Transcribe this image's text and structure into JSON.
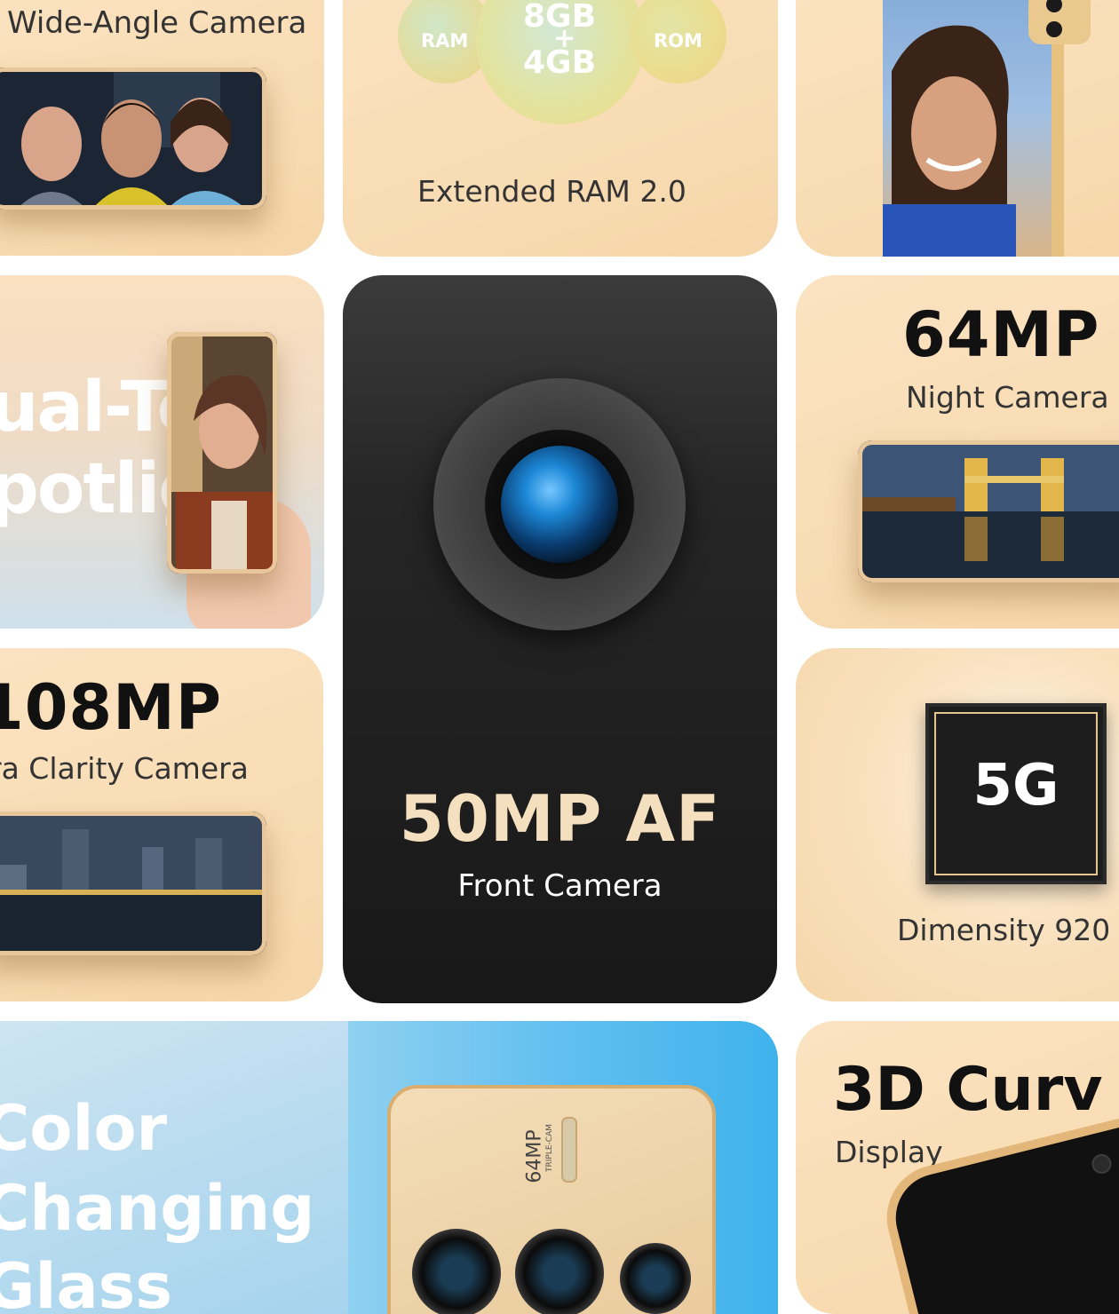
{
  "tiles": {
    "wide_angle": {
      "title": "Wide-Angle Camera"
    },
    "ram": {
      "ram_label": "RAM",
      "rom_label": "ROM",
      "capacity_top": "8GB",
      "capacity_plus": "+",
      "capacity_bottom": "4GB",
      "caption": "Extended RAM 2.0"
    },
    "dual_tone": {
      "line1": "ual-To",
      "line2": "potlig"
    },
    "front_camera": {
      "headline": "50MP AF",
      "caption": "Front Camera"
    },
    "night_camera": {
      "headline": "64MP",
      "caption": "Night Camera"
    },
    "ultra_clarity": {
      "headline": "108MP",
      "caption": "ra Clarity Camera"
    },
    "chipset": {
      "chip_label": "5G",
      "caption": "Dimensity 920"
    },
    "color_changing": {
      "line1": "Color",
      "line2": "Changing",
      "line3": "Glass"
    },
    "phone_back": {
      "badge_main": "64MP",
      "badge_sub": "TRIPLE-CAM"
    },
    "curved_display": {
      "headline": "3D Curv",
      "caption": "Display"
    }
  },
  "colors": {
    "peach": "#f8dcb3",
    "dark": "#1c1c1c",
    "gold_text": "#f4dfbf",
    "title_text": "#111111",
    "caption_text": "#333333"
  }
}
